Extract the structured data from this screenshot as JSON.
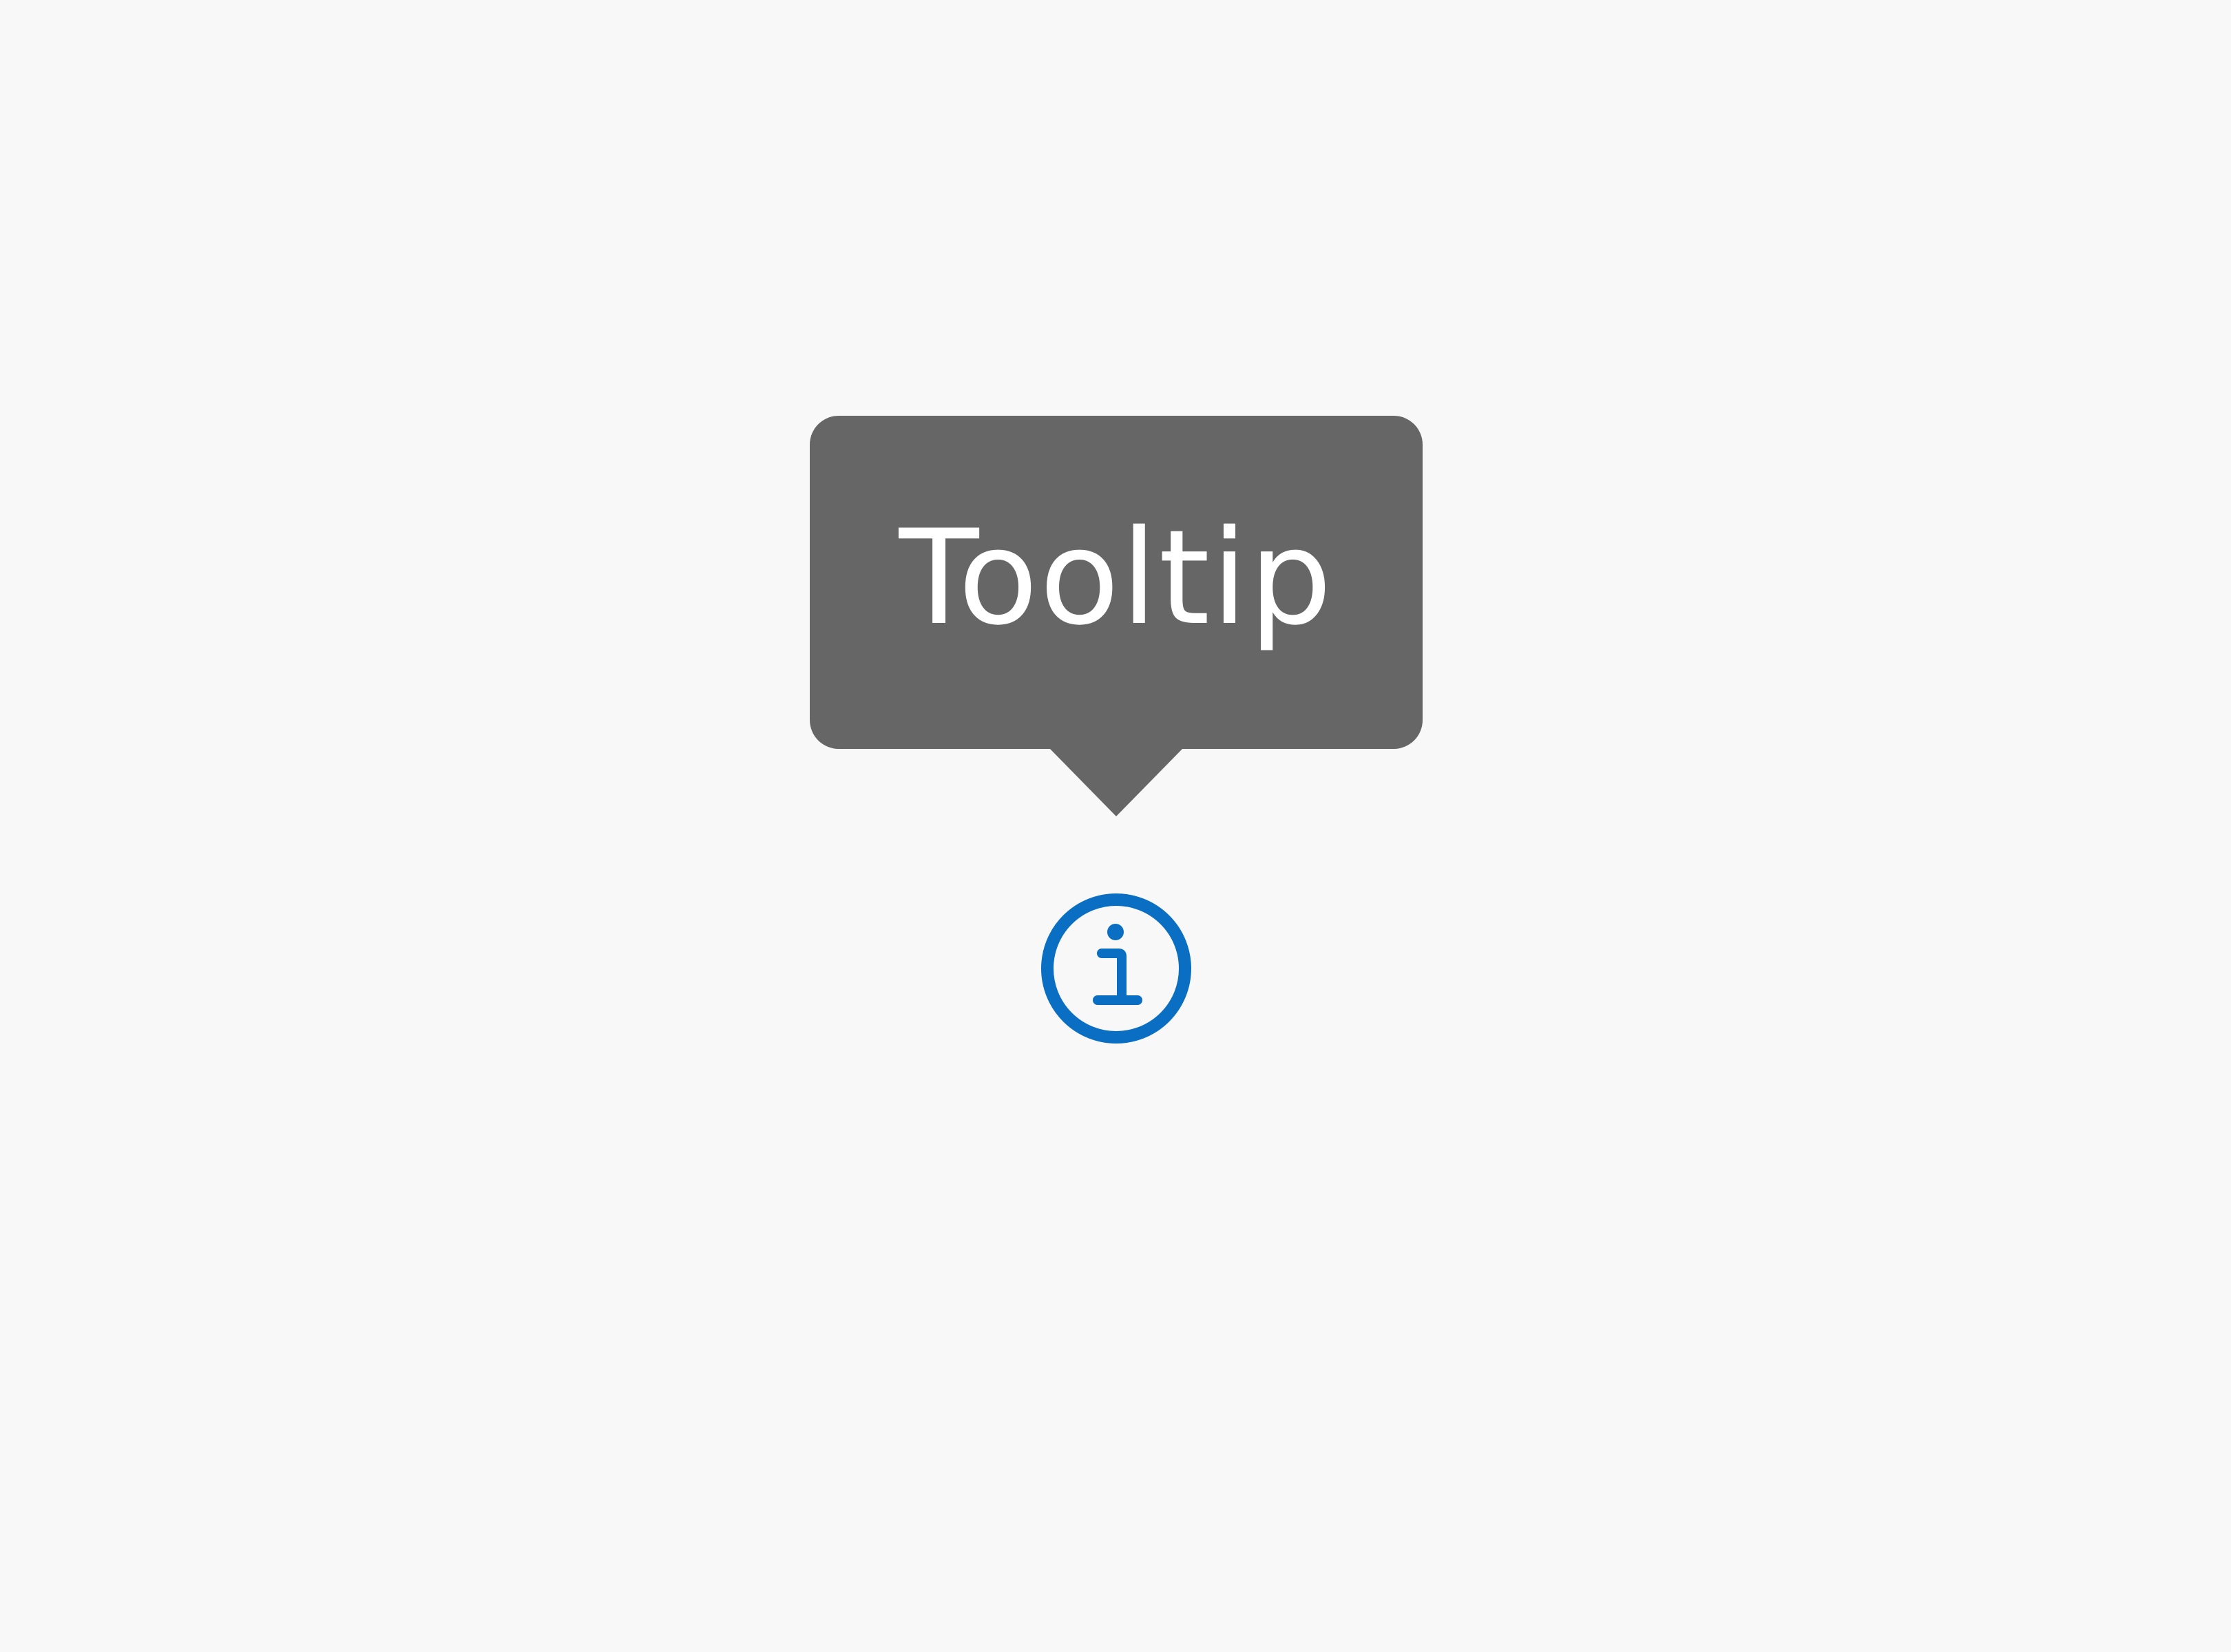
{
  "tooltip": {
    "text": "Tooltip"
  },
  "trigger": {
    "icon": "info-circle-icon",
    "accent_color": "#0a6fc2"
  },
  "colors": {
    "background": "#f8f8f8",
    "tooltip_background": "#666666",
    "tooltip_text": "#ffffff"
  }
}
